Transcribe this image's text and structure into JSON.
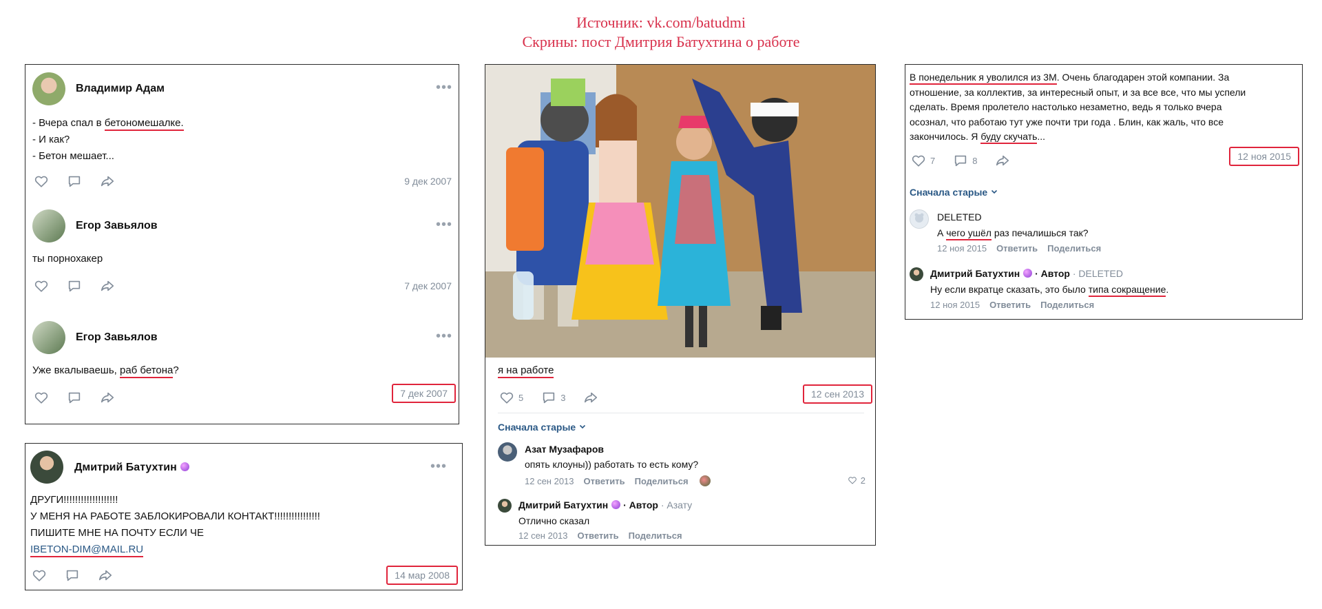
{
  "header": {
    "line1": "Источник: vk.com/batudmi",
    "line2": "Скрины: пост Дмитрия Батухтина о работе"
  },
  "panel1": {
    "posts": [
      {
        "author": "Владимир Адам",
        "lines": [
          "- Вчера спал в ",
          "бетономешалке.",
          "- И как?",
          "- Бетон мешает..."
        ],
        "date": "9 дек 2007"
      },
      {
        "author": "Егор Завьялов",
        "text": "ты порнохакер",
        "date": "7 дек 2007"
      },
      {
        "author": "Егор Завьялов",
        "text_a": "Уже вкалываешь, ",
        "text_b": "раб бетона",
        "text_c": "?",
        "date": "7 дек 2007"
      }
    ]
  },
  "panel2": {
    "author": "Дмитрий Батухтин",
    "lines": [
      "ДРУГИ!!!!!!!!!!!!!!!!!!!",
      "У МЕНЯ НА РАБОТЕ ЗАБЛОКИРОВАЛИ КОНТАКТ!!!!!!!!!!!!!!!!",
      "ПИШИТЕ МНЕ НА ПОЧТУ ЕСЛИ ЧЕ",
      "IBETON-DIM@MAIL.RU"
    ],
    "date": "14 мар 2008"
  },
  "panel3": {
    "caption": "я на работе",
    "likes": "5",
    "comments": "3",
    "date": "12 сен 2013",
    "sort_label": "Сначала старые",
    "comment1": {
      "author": "Азат Музафаров",
      "text": "опять клоуны)) работать то есть кому?",
      "date": "12 сен 2013",
      "reply": "Ответить",
      "share": "Поделиться",
      "likes": "2"
    },
    "comment2": {
      "author": "Дмитрий Батухтин",
      "role": "· Автор",
      "to": "· Азату",
      "text": "Отлично сказал",
      "date": "12 сен 2013",
      "reply": "Ответить",
      "share": "Поделиться"
    }
  },
  "panel4": {
    "text_l1a": "В понедельник я уволился из 3М",
    "text_l1b": ". Очень благодарен этой компании. За",
    "text_l2": "отношение, за коллектив, за интересный опыт, и за все все, что мы успели",
    "text_l3": "сделать. Время пролетело настолько незаметно, ведь я только вчера",
    "text_l4": "осознал, что работаю тут уже почти три года . Блин, как жаль, что все",
    "text_l5a": "закончилось. Я ",
    "text_l5b": "буду скучать",
    "text_l5c": "...",
    "likes": "7",
    "comments": "8",
    "date": "12 ноя 2015",
    "sort_label": "Сначала старые",
    "comment1": {
      "author": "DELETED",
      "text_a": "А ",
      "text_b": "чего ушёл",
      "text_c": " раз печалишься так?",
      "date": "12 ноя 2015",
      "reply": "Ответить",
      "share": "Поделиться"
    },
    "comment2": {
      "author": "Дмитрий Батухтин",
      "role": "· Автор",
      "to": "· DELETED",
      "text_a": "Ну если вкратце сказать, это было ",
      "text_b": "типа сокращение",
      "text_c": ".",
      "date": "12 ноя 2015",
      "reply": "Ответить",
      "share": "Поделиться"
    }
  },
  "colors": {
    "accent_red": "#e0243b",
    "header_red": "#d8304b",
    "link_blue": "#2a5885",
    "muted_gray": "#818c99"
  }
}
